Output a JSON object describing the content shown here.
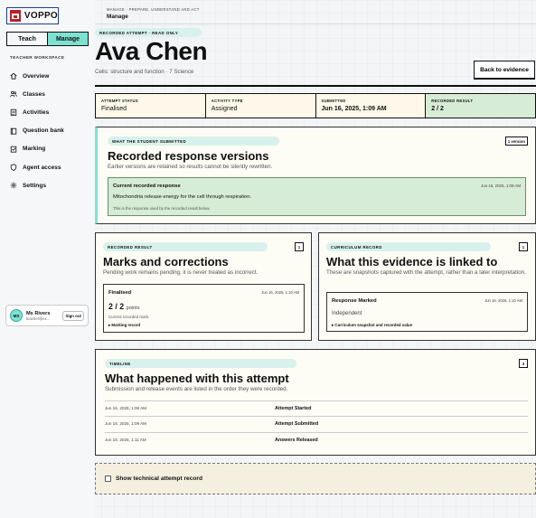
{
  "app": {
    "brand": "VOPPO"
  },
  "role_toggle": {
    "teach": "Teach",
    "manage": "Manage",
    "active": "Manage"
  },
  "sidebar": {
    "section_label": "TEACHER WORKSPACE",
    "items": [
      {
        "label": "Overview",
        "icon": "home-icon"
      },
      {
        "label": "Classes",
        "icon": "users-icon"
      },
      {
        "label": "Activities",
        "icon": "clipboard-icon"
      },
      {
        "label": "Question bank",
        "icon": "book-icon"
      },
      {
        "label": "Marking",
        "icon": "marking-icon"
      },
      {
        "label": "Agent access",
        "icon": "shield-icon"
      },
      {
        "label": "Settings",
        "icon": "gear-icon"
      }
    ]
  },
  "user": {
    "initials": "MS",
    "name": "Ms Rivers",
    "email": "teacher@ex...",
    "signout": "Sign out"
  },
  "header": {
    "breadcrumb": "MANAGE · PREPARE, UNDERSTAND AND ACT",
    "section": "Manage",
    "readonly_label": "RECORDED ATTEMPT · READ ONLY",
    "student_name": "Ava Chen",
    "subtitle": "Cells: structure and function · 7 Science",
    "back_button": "Back to evidence"
  },
  "summary": [
    {
      "label": "ATTEMPT STATUS",
      "value": "Finalised"
    },
    {
      "label": "ACTIVITY TYPE",
      "value": "Assigned"
    },
    {
      "label": "SUBMITTED",
      "value": "Jun 16, 2025, 1:09 AM"
    },
    {
      "label": "RECORDED RESULT",
      "value": "2 / 2"
    }
  ],
  "submission": {
    "label": "WHAT THE STUDENT SUBMITTED",
    "badge": "1 version",
    "title": "Recorded response versions",
    "description": "Earlier versions are retained so results cannot be silently rewritten.",
    "response": {
      "heading": "Current recorded response",
      "date": "Jun 16, 2025, 1:08 AM",
      "text": "Mitochondria release energy for the cell through respiration.",
      "note": "This is the response used by the recorded result below."
    }
  },
  "marks": {
    "label": "RECORDED RESULT",
    "badge": "1",
    "title": "Marks and corrections",
    "description": "Pending work remains pending; it is never treated as incorrect.",
    "entry": {
      "status": "Finalised",
      "date": "Jun 16, 2025, 1:10 AM",
      "score": "2 / 2",
      "score_unit": "points",
      "note": "Current recorded mark.",
      "details": "▸ Marking record"
    }
  },
  "curriculum": {
    "label": "CURRICULUM RECORD",
    "badge": "1",
    "title": "What this evidence is linked to",
    "description": "These are snapshots captured with the attempt, rather than a later interpretation.",
    "entry": {
      "heading": "Response Marked",
      "date": "Jun 16, 2025, 1:10 AM",
      "value": "Independent",
      "details": "▸ Curriculum snapshot and recorded value"
    }
  },
  "timeline": {
    "label": "TIMELINE",
    "badge": "3",
    "title": "What happened with this attempt",
    "description": "Submission and release events are listed in the order they were recorded.",
    "events": [
      {
        "date": "Jun 16, 2025, 1:06 AM",
        "event": "Attempt Started"
      },
      {
        "date": "Jun 16, 2025, 1:09 AM",
        "event": "Attempt Submitted"
      },
      {
        "date": "Jun 16, 2025, 1:11 AM",
        "event": "Answers Released"
      }
    ]
  },
  "technical": {
    "label": "Show technical attempt record",
    "checked": false
  },
  "colors": {
    "accent": "#7ee1d2",
    "brand": "#1b3d8f",
    "success_bg": "#d6ecd6",
    "cream": "#fdf8e9"
  }
}
